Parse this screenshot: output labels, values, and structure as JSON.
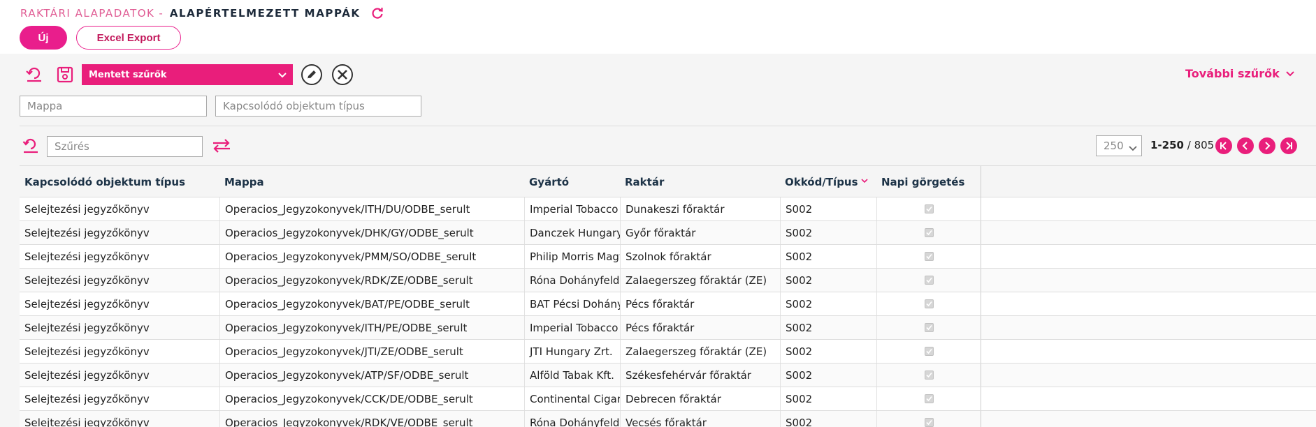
{
  "header": {
    "title_prefix": "RAKTÁRI ALAPADATOK",
    "title_separator": "-",
    "title_main": "ALAPÉRTELMEZETT MAPPÁK",
    "new_label": "Új",
    "excel_label": "Excel Export"
  },
  "toolbar": {
    "saved_filters_label": "Mentett szűrők",
    "more_filters_label": "További szűrők",
    "folder_placeholder": "Mappa",
    "object_type_placeholder": "Kapcsolódó objektum típus",
    "filter_placeholder": "Szűrés"
  },
  "pager": {
    "page_size": "250",
    "range": "1-250",
    "total": "/ 805"
  },
  "table": {
    "columns": [
      "Kapcsolódó objektum típus",
      "Mappa",
      "Gyártó",
      "Raktár",
      "Okkód/Típus",
      "Napi görgetés"
    ],
    "rows": [
      {
        "type": "Selejtezési jegyzőkönyv",
        "folder": "Operacios_Jegyzokonyvek/ITH/DU/ODBE_serult",
        "maker": "Imperial Tobacco M",
        "warehouse": "Dunakeszi főraktár",
        "code": "S002",
        "daily": true
      },
      {
        "type": "Selejtezési jegyzőkönyv",
        "folder": "Operacios_Jegyzokonyvek/DHK/GY/ODBE_serult",
        "maker": "Danczek Hungary K",
        "warehouse": "Győr főraktár",
        "code": "S002",
        "daily": true
      },
      {
        "type": "Selejtezési jegyzőkönyv",
        "folder": "Operacios_Jegyzokonyvek/PMM/SO/ODBE_serult",
        "maker": "Philip Morris Magy",
        "warehouse": "Szolnok főraktár",
        "code": "S002",
        "daily": true
      },
      {
        "type": "Selejtezési jegyzőkönyv",
        "folder": "Operacios_Jegyzokonyvek/RDK/ZE/ODBE_serult",
        "maker": "Róna Dohányfeldo",
        "warehouse": "Zalaegerszeg főraktár (ZE)",
        "code": "S002",
        "daily": true
      },
      {
        "type": "Selejtezési jegyzőkönyv",
        "folder": "Operacios_Jegyzokonyvek/BAT/PE/ODBE_serult",
        "maker": "BAT Pécsi Dohánygy",
        "warehouse": "Pécs főraktár",
        "code": "S002",
        "daily": true
      },
      {
        "type": "Selejtezési jegyzőkönyv",
        "folder": "Operacios_Jegyzokonyvek/ITH/PE/ODBE_serult",
        "maker": "Imperial Tobacco M",
        "warehouse": "Pécs főraktár",
        "code": "S002",
        "daily": true
      },
      {
        "type": "Selejtezési jegyzőkönyv",
        "folder": "Operacios_Jegyzokonyvek/JTI/ZE/ODBE_serult",
        "maker": "JTI Hungary Zrt.",
        "warehouse": "Zalaegerszeg főraktár (ZE)",
        "code": "S002",
        "daily": true
      },
      {
        "type": "Selejtezési jegyzőkönyv",
        "folder": "Operacios_Jegyzokonyvek/ATP/SF/ODBE_serult",
        "maker": "Alföld Tabak Kft.",
        "warehouse": "Székesfehérvár főraktár",
        "code": "S002",
        "daily": true
      },
      {
        "type": "Selejtezési jegyzőkönyv",
        "folder": "Operacios_Jegyzokonyvek/CCK/DE/ODBE_serult",
        "maker": "Continental Cigar H",
        "warehouse": "Debrecen főraktár",
        "code": "S002",
        "daily": true
      },
      {
        "type": "Selejtezési jegyzőkönyv",
        "folder": "Operacios_Jegyzokonyvek/RDK/VE/ODBE_serult",
        "maker": "Róna Dohányfeldo",
        "warehouse": "Vecsés főraktár",
        "code": "S002",
        "daily": true
      }
    ]
  },
  "colors": {
    "accent": "#e91e7b",
    "title_pink": "#e05c94",
    "heading_dark": "#1d3347"
  },
  "icons": [
    "refresh-icon",
    "reset-filter-icon",
    "save-icon",
    "chevron-down-icon",
    "edit-icon",
    "close-icon",
    "swap-icon",
    "first-page-icon",
    "prev-page-icon",
    "next-page-icon",
    "last-page-icon",
    "sort-desc-icon",
    "checkbox-checked-icon"
  ]
}
